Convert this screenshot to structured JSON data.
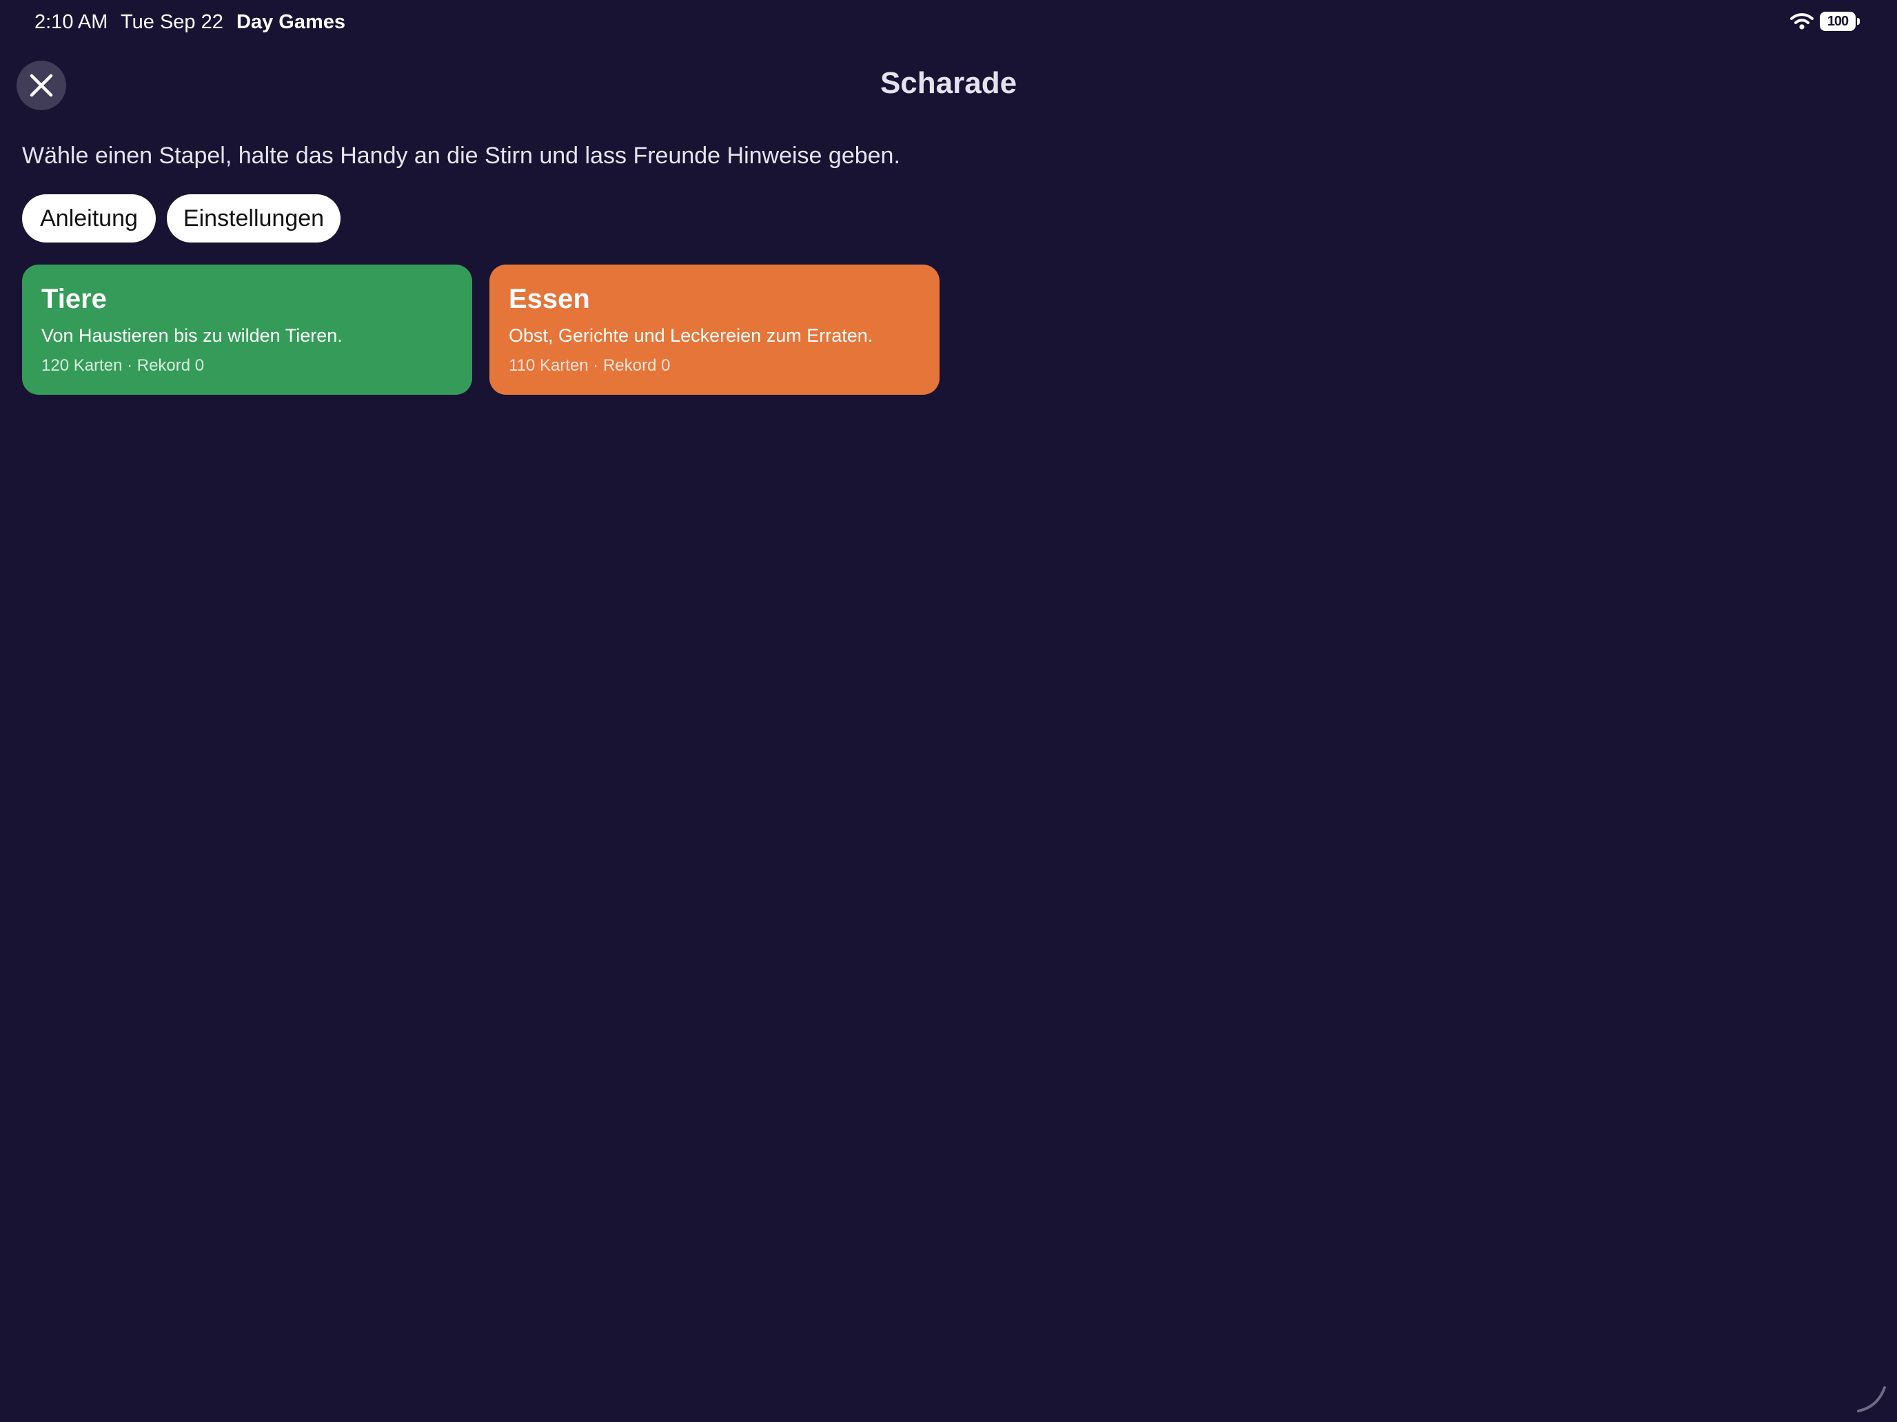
{
  "status_bar": {
    "time": "2:10 AM",
    "date": "Tue Sep 22",
    "app_name": "Day Games",
    "battery": "100"
  },
  "header": {
    "title": "Scharade"
  },
  "intro": {
    "text": "Wähle einen Stapel, halte das Handy an die Stirn und lass Freunde Hinweise geben."
  },
  "buttons": {
    "help_label": "Anleitung",
    "settings_label": "Einstellungen"
  },
  "decks": [
    {
      "title": "Tiere",
      "description": "Von Haustieren bis zu wilden Tieren.",
      "meta": "120 Karten · Rekord 0",
      "color": "#349c58"
    },
    {
      "title": "Essen",
      "description": "Obst, Gerichte und Leckereien zum Erraten.",
      "meta": "110 Karten · Rekord 0",
      "color": "#e57539"
    }
  ],
  "colors": {
    "background": "#181233",
    "close_button": "#413c58"
  }
}
